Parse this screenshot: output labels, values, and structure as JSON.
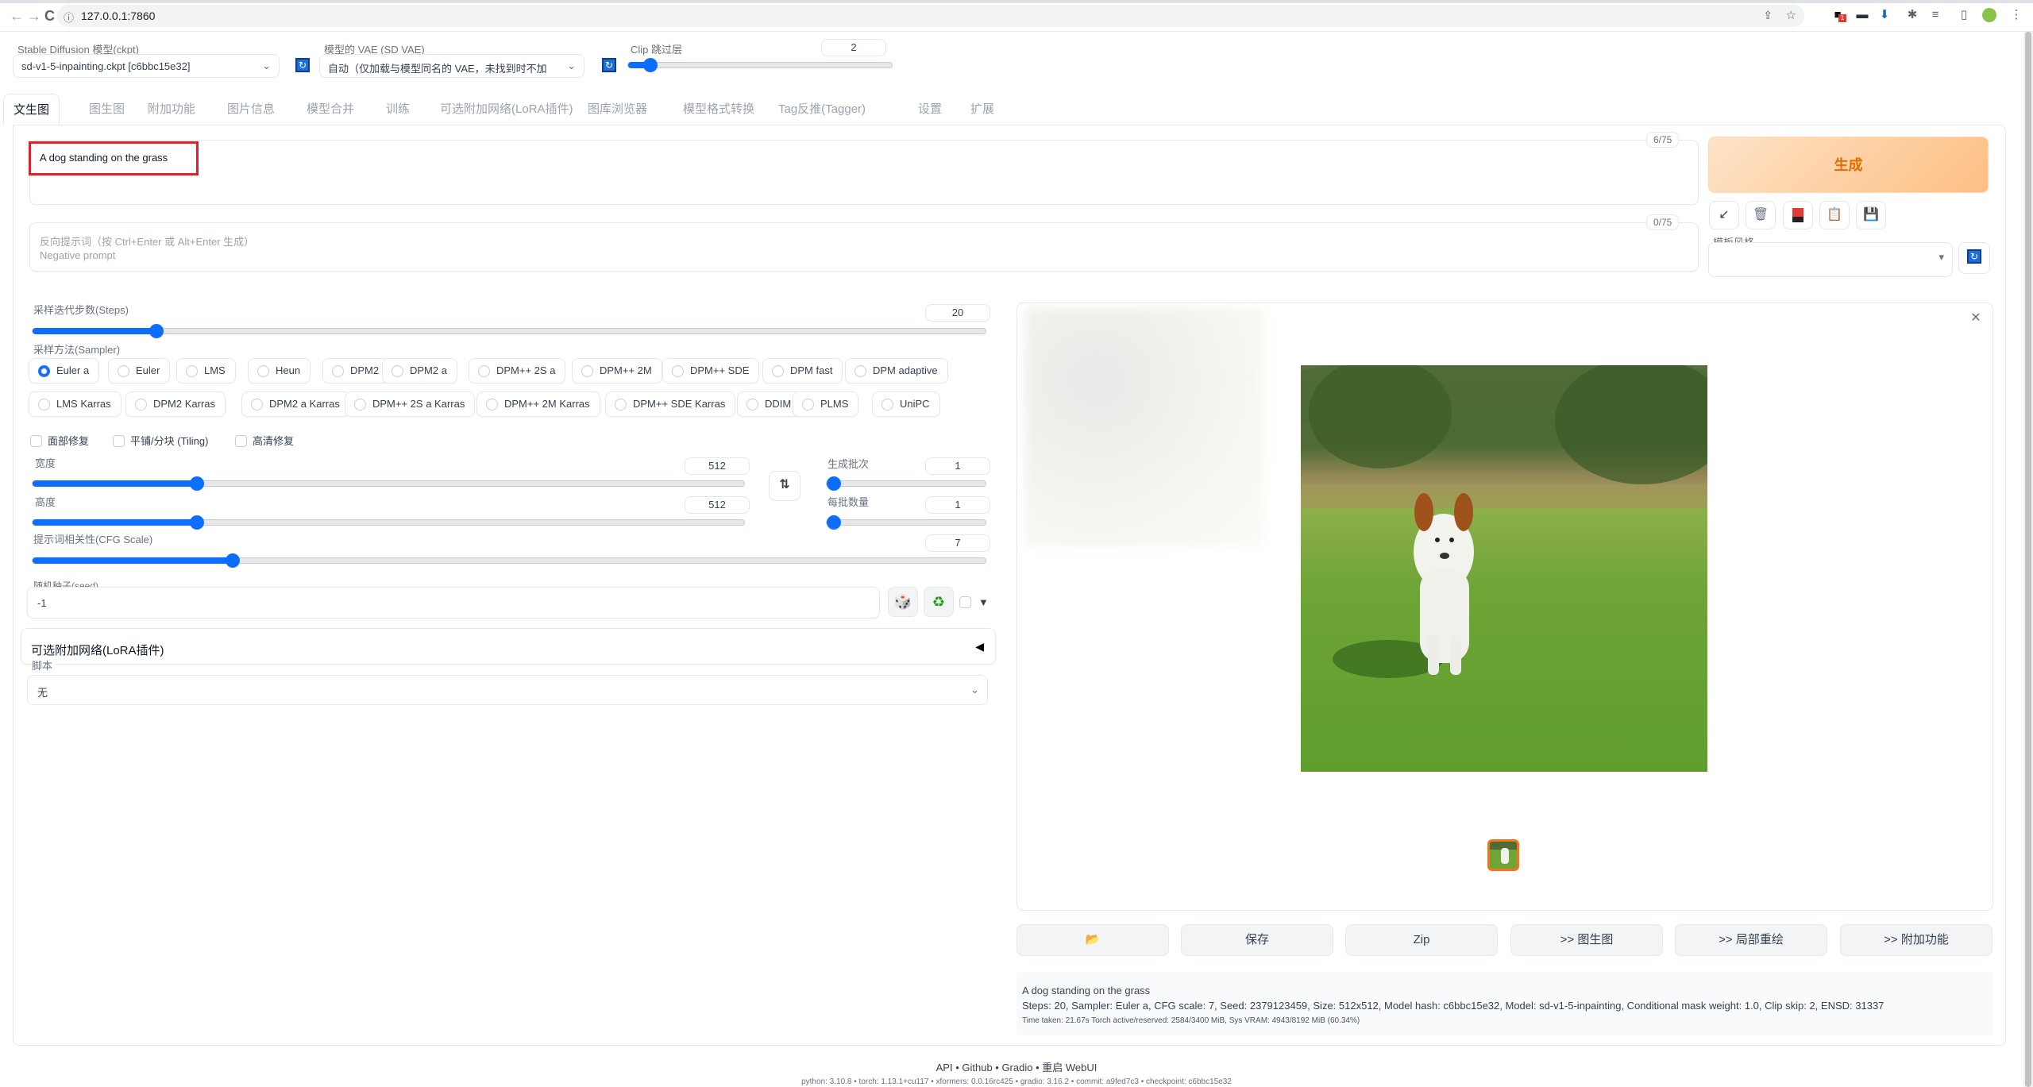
{
  "browser": {
    "url": "127.0.0.1:7860",
    "nav": {
      "back": "←",
      "forward": "→",
      "reload": "C",
      "info": "ⓘ"
    },
    "extension_badge": "1"
  },
  "settings": {
    "model_label": "Stable Diffusion 模型(ckpt)",
    "model_value": "sd-v1-5-inpainting.ckpt [c6bbc15e32]",
    "vae_label": "模型的 VAE (SD VAE)",
    "vae_value": "自动（仅加载与模型同名的 VAE，未找到时不加",
    "clip_label": "Clip 跳过层",
    "clip_value": "2",
    "clip_fraction": 0.083
  },
  "tabs": [
    "文生图",
    "图生图",
    "附加功能",
    "图片信息",
    "模型合并",
    "训练",
    "可选附加网络(LoRA插件)",
    "图库浏览器",
    "模型格式转换",
    "Tag反推(Tagger)",
    "设置",
    "扩展"
  ],
  "active_tab": 0,
  "prompt": {
    "value": "A dog standing on the grass",
    "counter": "6/75",
    "negative_placeholder_line1": "反向提示词（按 Ctrl+Enter 或 Alt+Enter 生成）",
    "negative_placeholder_line2": "Negative prompt",
    "negative_counter": "0/75"
  },
  "generate_label": "生成",
  "tool_icons": [
    "arrow-icon",
    "trash-icon",
    "card-icon",
    "clipboard-icon",
    "save-icon"
  ],
  "style": {
    "label": "模板风格",
    "value": ""
  },
  "steps": {
    "label": "采样迭代步数(Steps)",
    "value": "20",
    "fraction": 0.13
  },
  "sampler": {
    "label": "采样方法(Sampler)",
    "row1": [
      "Euler a",
      "Euler",
      "LMS",
      "Heun",
      "DPM2",
      "DPM2 a",
      "DPM++ 2S a",
      "DPM++ 2M",
      "DPM++ SDE",
      "DPM fast",
      "DPM adaptive"
    ],
    "row2": [
      "LMS Karras",
      "DPM2 Karras",
      "DPM2 a Karras",
      "DPM++ 2S a Karras",
      "DPM++ 2M Karras",
      "DPM++ SDE Karras",
      "DDIM",
      "PLMS",
      "UniPC"
    ],
    "selected": "Euler a"
  },
  "checks": [
    "面部修复",
    "平铺/分块 (Tiling)",
    "高清修复"
  ],
  "width": {
    "label": "宽度",
    "value": "512",
    "fraction": 0.23
  },
  "height": {
    "label": "高度",
    "value": "512",
    "fraction": 0.23
  },
  "batch_count": {
    "label": "生成批次",
    "value": "1",
    "fraction": 0.0
  },
  "batch_size": {
    "label": "每批数量",
    "value": "1",
    "fraction": 0.0
  },
  "cfg": {
    "label": "提示词相关性(CFG Scale)",
    "value": "7",
    "fraction": 0.21
  },
  "seed": {
    "label": "随机种子(seed)",
    "value": "-1"
  },
  "lora_accordion": {
    "label": "可选附加网络(LoRA插件)",
    "arrow": "◀"
  },
  "script": {
    "label": "脚本",
    "value": "无"
  },
  "actions": [
    "📂",
    "保存",
    "Zip",
    ">> 图生图",
    ">> 局部重绘",
    ">> 附加功能"
  ],
  "info": {
    "prompt": "A dog standing on the grass",
    "params": "Steps: 20, Sampler: Euler a, CFG scale: 7, Seed: 2379123459, Size: 512x512, Model hash: c6bbc15e32, Model: sd-v1-5-inpainting, Conditional mask weight: 1.0, Clip skip: 2, ENSD: 31337",
    "time": "Time taken: 21.67s  Torch active/reserved: 2584/3400 MiB, Sys VRAM: 4943/8192 MiB (60.34%)"
  },
  "footer": {
    "links": "API • Github • Gradio • 重启 WebUI",
    "versions": "python: 3.10.8  •  torch: 1.13.1+cu117  •  xformers: 0.0.16rc425  •  gradio: 3.16.2  •  commit: a9fed7c3  •  checkpoint: c6bbc15e32"
  }
}
